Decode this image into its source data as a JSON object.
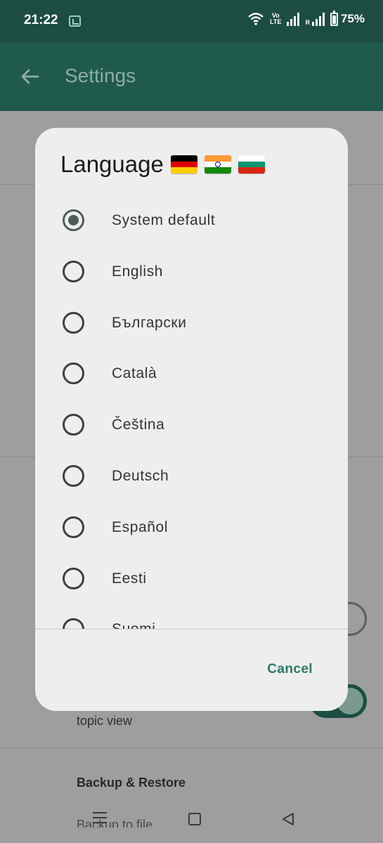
{
  "status_bar": {
    "time": "21:22",
    "volte_top": "Vo",
    "volte_bottom": "LTE",
    "roaming": "R",
    "battery": "75%"
  },
  "app_bar": {
    "title": "Settings"
  },
  "background": {
    "topic_text": "topic view",
    "section_header": "Backup & Restore",
    "partial_text": "Backup to file"
  },
  "dialog": {
    "title": "Language",
    "flags": [
      "flag-germany-icon",
      "flag-india-icon",
      "flag-bulgaria-icon"
    ],
    "options": [
      {
        "label": "System default",
        "selected": true
      },
      {
        "label": "English",
        "selected": false
      },
      {
        "label": "Български",
        "selected": false
      },
      {
        "label": "Català",
        "selected": false
      },
      {
        "label": "Čeština",
        "selected": false
      },
      {
        "label": "Deutsch",
        "selected": false
      },
      {
        "label": "Español",
        "selected": false
      },
      {
        "label": "Eesti",
        "selected": false
      },
      {
        "label": "Suomi",
        "selected": false
      }
    ],
    "cancel_label": "Cancel"
  },
  "colors": {
    "app_bar": "#1f5a4c",
    "accent": "#2c7a66",
    "dialog_bg": "#eeeeee"
  }
}
